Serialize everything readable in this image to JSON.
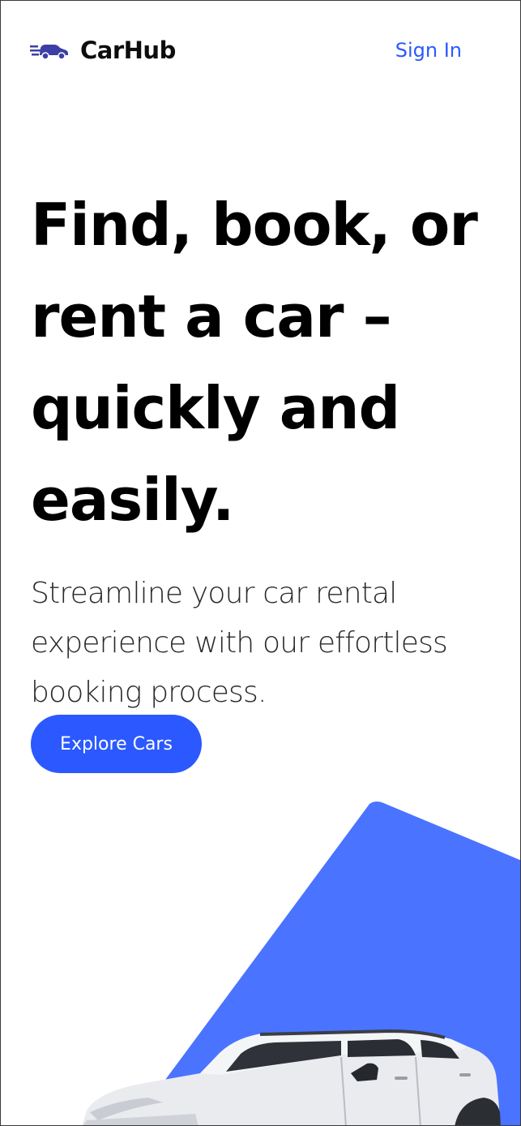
{
  "header": {
    "brand_name": "CarHub",
    "signin_label": "Sign In",
    "logo_icon": "car-speed-icon"
  },
  "hero": {
    "title": "Find, book, or rent a car – quickly and easily.",
    "subtitle": "Streamline your car rental experience with our effortless booking process.",
    "cta_label": "Explore Cars"
  },
  "colors": {
    "accent": "#2b59ff",
    "accent_shape": "#4a73ff",
    "text_dark": "#000000",
    "text_body": "#2a2a2a"
  }
}
